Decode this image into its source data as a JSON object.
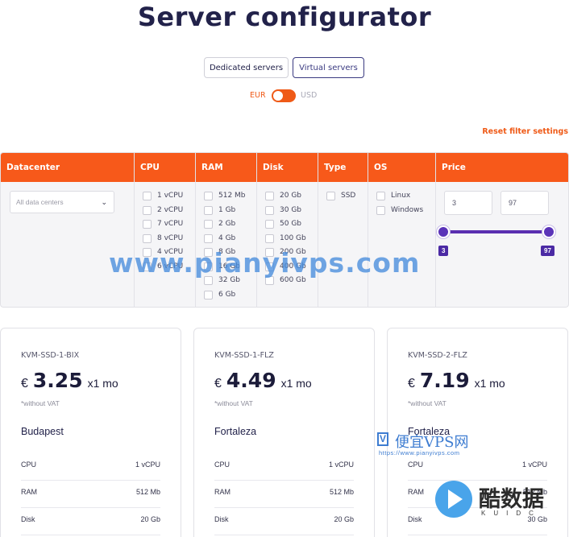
{
  "page_title": "Server configurator",
  "server_tabs": [
    {
      "label": "Dedicated servers",
      "active": false
    },
    {
      "label": "Virtual servers",
      "active": true
    }
  ],
  "currency": {
    "eur": "EUR",
    "usd": "USD",
    "selected": "EUR"
  },
  "reset_label": "Reset filter settings",
  "filter": {
    "headers": {
      "datacenter": "Datacenter",
      "cpu": "CPU",
      "ram": "RAM",
      "disk": "Disk",
      "type": "Type",
      "os": "OS",
      "price": "Price"
    },
    "datacenter_placeholder": "All data centers",
    "cpu_options": [
      "1 vCPU",
      "2 vCPU",
      "7 vCPU",
      "8 vCPU",
      "4 vCPU",
      "6 vCPU"
    ],
    "ram_options": [
      "512 Mb",
      "1 Gb",
      "2 Gb",
      "4 Gb",
      "8 Gb",
      "16 Gb",
      "32 Gb",
      "6 Gb"
    ],
    "disk_options": [
      "20 Gb",
      "30 Gb",
      "50 Gb",
      "100 Gb",
      "200 Gb",
      "400 Gb",
      "600 Gb"
    ],
    "type_options": [
      "SSD"
    ],
    "os_options": [
      "Linux",
      "Windows"
    ],
    "price": {
      "min": "3",
      "max": "97",
      "min_tag": "3",
      "max_tag": "97"
    }
  },
  "cards": [
    {
      "name": "KVM-SSD-1-BIX",
      "currency_symbol": "€",
      "price": "3.25",
      "period": "x1 mo",
      "vat": "*without VAT",
      "location": "Budapest",
      "specs": [
        {
          "k": "CPU",
          "v": "1 vCPU"
        },
        {
          "k": "RAM",
          "v": "512 Mb"
        },
        {
          "k": "Disk",
          "v": "20 Gb"
        }
      ]
    },
    {
      "name": "KVM-SSD-1-FLZ",
      "currency_symbol": "€",
      "price": "4.49",
      "period": "x1 mo",
      "vat": "*without VAT",
      "location": "Fortaleza",
      "specs": [
        {
          "k": "CPU",
          "v": "1 vCPU"
        },
        {
          "k": "RAM",
          "v": "512 Mb"
        },
        {
          "k": "Disk",
          "v": "20 Gb"
        }
      ]
    },
    {
      "name": "KVM-SSD-2-FLZ",
      "currency_symbol": "€",
      "price": "7.19",
      "period": "x1 mo",
      "vat": "*without VAT",
      "location": "Fortaleza",
      "specs": [
        {
          "k": "CPU",
          "v": "1 vCPU"
        },
        {
          "k": "RAM",
          "v": "512 Mb"
        },
        {
          "k": "Disk",
          "v": "30 Gb"
        }
      ]
    }
  ],
  "watermarks": {
    "main": "www.pianyivps.com",
    "badge_letter": "V",
    "badge_text": "便宜VPS网",
    "badge_url": "https://www.pianyivps.com",
    "logo_text": "酷数据",
    "logo_sub": "KUIDC"
  },
  "colors": {
    "accent": "#f7591a",
    "slider": "#5a33b8",
    "ink": "#22224a"
  }
}
